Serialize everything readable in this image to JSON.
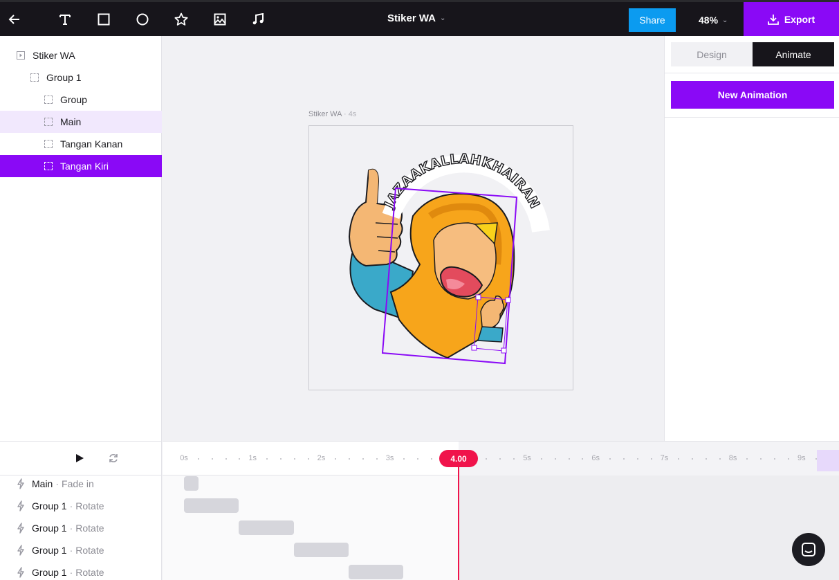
{
  "toolbar": {
    "icons": [
      "back-arrow-icon",
      "text-tool-icon",
      "rectangle-tool-icon",
      "circle-tool-icon",
      "star-tool-icon",
      "image-tool-icon",
      "music-tool-icon"
    ],
    "document_title": "Stiker WA",
    "share_label": "Share",
    "zoom_label": "48%",
    "export_label": "Export"
  },
  "layers": {
    "items": [
      {
        "label": "Stiker WA",
        "state": "normal"
      },
      {
        "label": "Group 1",
        "state": "normal"
      },
      {
        "label": "Group",
        "state": "normal"
      },
      {
        "label": "Main",
        "state": "hover"
      },
      {
        "label": "Tangan Kanan",
        "state": "normal"
      },
      {
        "label": "Tangan Kiri",
        "state": "selected"
      }
    ]
  },
  "canvas": {
    "frame_name": "Stiker WA",
    "frame_separator": "·",
    "frame_duration": "4s",
    "sticker_text": "JAZAAKALLAHKHAIRAN"
  },
  "panel": {
    "tabs": [
      {
        "label": "Design",
        "active": false
      },
      {
        "label": "Animate",
        "active": true
      }
    ],
    "new_animation_label": "New Animation"
  },
  "timeline": {
    "ruler_labels": [
      "0s",
      "1s",
      "2s",
      "3s",
      "5s",
      "6s",
      "7s",
      "8s",
      "9s"
    ],
    "playhead_label": "4.00",
    "playhead_seconds": 4.0,
    "tracks": [
      {
        "layer": "Main",
        "separator": "·",
        "animation": "Fade in",
        "start_s": 0.0,
        "end_s": 0.2
      },
      {
        "layer": "Group 1",
        "separator": "·",
        "animation": "Rotate",
        "start_s": 0.0,
        "end_s": 0.8
      },
      {
        "layer": "Group 1",
        "separator": "·",
        "animation": "Rotate",
        "start_s": 0.8,
        "end_s": 1.6
      },
      {
        "layer": "Group 1",
        "separator": "·",
        "animation": "Rotate",
        "start_s": 1.6,
        "end_s": 2.4
      },
      {
        "layer": "Group 1",
        "separator": "·",
        "animation": "Rotate",
        "start_s": 2.4,
        "end_s": 3.2
      }
    ]
  },
  "colors": {
    "accent": "#8a09f6",
    "share": "#0b9bf0",
    "playhead": "#f0134b",
    "topbar": "#17151b"
  }
}
